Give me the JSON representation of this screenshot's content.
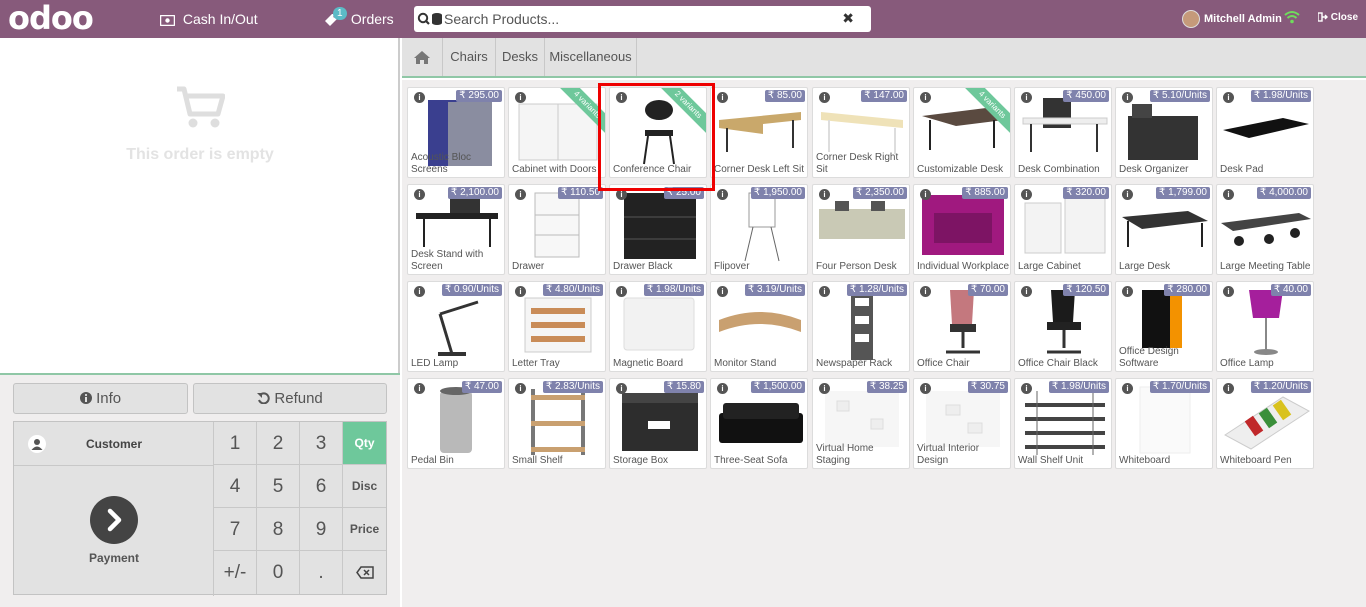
{
  "header": {
    "logo": "odoo",
    "cash_label": "Cash In/Out",
    "orders_label": "Orders",
    "orders_badge": "1",
    "search_placeholder": "Search Products...",
    "user_name": "Mitchell Admin",
    "close_label": "Close"
  },
  "order": {
    "empty_text": "This order is empty"
  },
  "controls": {
    "info_label": "Info",
    "refund_label": "Refund",
    "customer_label": "Customer",
    "payment_label": "Payment",
    "keys": [
      "1",
      "2",
      "3",
      "4",
      "5",
      "6",
      "7",
      "8",
      "9",
      "+/-",
      "0",
      "."
    ],
    "modes": [
      "Qty",
      "Disc",
      "Price"
    ]
  },
  "categories": [
    "Chairs",
    "Desks",
    "Miscellaneous"
  ],
  "products": [
    {
      "name": "Acoustic Bloc Screens",
      "price": "₹ 295.00"
    },
    {
      "name": "Cabinet with Doors",
      "price": "",
      "ribbon": "4 variants"
    },
    {
      "name": "Conference Chair",
      "price": "",
      "ribbon": "2 variants"
    },
    {
      "name": "Corner Desk Left Sit",
      "price": "₹ 85.00"
    },
    {
      "name": "Corner Desk Right Sit",
      "price": "₹ 147.00"
    },
    {
      "name": "Customizable Desk",
      "price": "",
      "ribbon": "4 variants"
    },
    {
      "name": "Desk Combination",
      "price": "₹ 450.00"
    },
    {
      "name": "Desk Organizer",
      "price": "₹ 5.10/Units"
    },
    {
      "name": "Desk Pad",
      "price": "₹ 1.98/Units"
    },
    {
      "name": "Desk Stand with Screen",
      "price": "₹ 2,100.00"
    },
    {
      "name": "Drawer",
      "price": "₹ 110.50"
    },
    {
      "name": "Drawer Black",
      "price": "₹ 25.00"
    },
    {
      "name": "Flipover",
      "price": "₹ 1,950.00"
    },
    {
      "name": "Four Person Desk",
      "price": "₹ 2,350.00"
    },
    {
      "name": "Individual Workplace",
      "price": "₹ 885.00"
    },
    {
      "name": "Large Cabinet",
      "price": "₹ 320.00"
    },
    {
      "name": "Large Desk",
      "price": "₹ 1,799.00"
    },
    {
      "name": "Large Meeting Table",
      "price": "₹ 4,000.00"
    },
    {
      "name": "LED Lamp",
      "price": "₹ 0.90/Units"
    },
    {
      "name": "Letter Tray",
      "price": "₹ 4.80/Units"
    },
    {
      "name": "Magnetic Board",
      "price": "₹ 1.98/Units"
    },
    {
      "name": "Monitor Stand",
      "price": "₹ 3.19/Units"
    },
    {
      "name": "Newspaper Rack",
      "price": "₹ 1.28/Units"
    },
    {
      "name": "Office Chair",
      "price": "₹ 70.00"
    },
    {
      "name": "Office Chair Black",
      "price": "₹ 120.50"
    },
    {
      "name": "Office Design Software",
      "price": "₹ 280.00"
    },
    {
      "name": "Office Lamp",
      "price": "₹ 40.00"
    },
    {
      "name": "Pedal Bin",
      "price": "₹ 47.00"
    },
    {
      "name": "Small Shelf",
      "price": "₹ 2.83/Units"
    },
    {
      "name": "Storage Box",
      "price": "₹ 15.80"
    },
    {
      "name": "Three-Seat Sofa",
      "price": "₹ 1,500.00"
    },
    {
      "name": "Virtual Home Staging",
      "price": "₹ 38.25"
    },
    {
      "name": "Virtual Interior Design",
      "price": "₹ 30.75"
    },
    {
      "name": "Wall Shelf Unit",
      "price": "₹ 1.98/Units"
    },
    {
      "name": "Whiteboard",
      "price": "₹ 1.70/Units"
    },
    {
      "name": "Whiteboard Pen",
      "price": "₹ 1.20/Units"
    }
  ],
  "colors": {
    "brand": "#875a7b",
    "accent": "#6ec89b",
    "price_tag": "#7f82ac",
    "highlight": "#ee0000"
  }
}
